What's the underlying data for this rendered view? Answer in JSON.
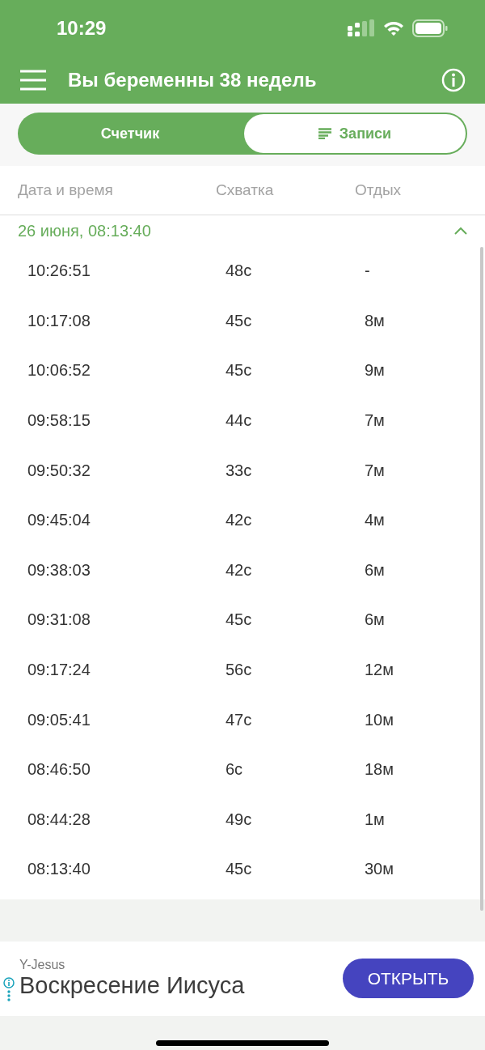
{
  "status_bar": {
    "time": "10:29"
  },
  "app_bar": {
    "title": "Вы беременны 38 недель"
  },
  "segments": [
    {
      "label": "Счетчик",
      "selected": false
    },
    {
      "label": "Записи",
      "selected": true
    }
  ],
  "table": {
    "columns": [
      "Дата и время",
      "Схватка",
      "Отдых"
    ],
    "group": {
      "title": "26 июня, 08:13:40",
      "expanded": true
    },
    "rows": [
      [
        "10:26:51",
        "48с",
        "-"
      ],
      [
        "10:17:08",
        "45с",
        "8м"
      ],
      [
        "10:06:52",
        "45с",
        "9м"
      ],
      [
        "09:58:15",
        "44с",
        "7м"
      ],
      [
        "09:50:32",
        "33с",
        "7м"
      ],
      [
        "09:45:04",
        "42с",
        "4м"
      ],
      [
        "09:38:03",
        "42с",
        "6м"
      ],
      [
        "09:31:08",
        "45с",
        "6м"
      ],
      [
        "09:17:24",
        "56с",
        "12м"
      ],
      [
        "09:05:41",
        "47с",
        "10м"
      ],
      [
        "08:46:50",
        "6с",
        "18м"
      ],
      [
        "08:44:28",
        "49с",
        "1м"
      ],
      [
        "08:13:40",
        "45с",
        "30м"
      ]
    ]
  },
  "ad": {
    "advertiser": "Y-Jesus",
    "headline": "Воскресение Иисуса",
    "button": "ОТКРЫТЬ"
  }
}
